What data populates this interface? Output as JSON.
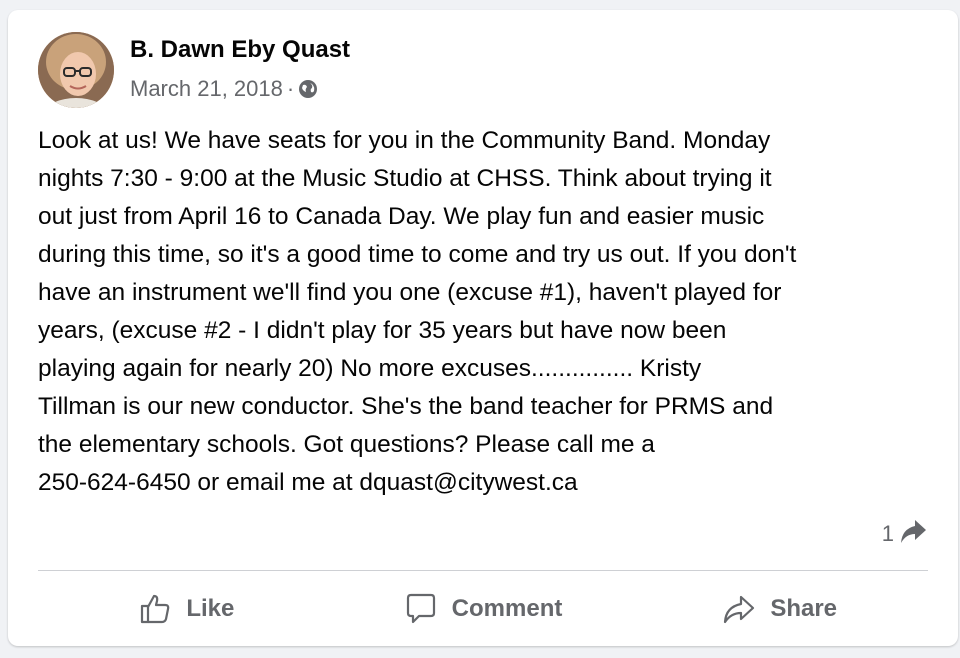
{
  "post": {
    "author_name": "B. Dawn Eby Quast",
    "date": "March 21, 2018",
    "separator": "·",
    "privacy_icon": "globe-icon",
    "body": "Look at us!  We have seats for you in the Community Band.  Monday\nnights 7:30 - 9:00 at the Music Studio at CHSS.   Think about trying it\nout just from April 16 to Canada Day.  We play fun and easier music\nduring this time, so it's a good time to come and try us out.  If you don't\nhave an instrument we'll find you one (excuse #1), haven't played for\nyears, (excuse #2 - I didn't play for 35 years but have now been\nplaying again for nearly 20)   No more excuses...............  Kristy\nTillman is our new conductor.  She's the band teacher for PRMS and\nthe elementary schools.  Got questions?  Please call me a\n250-624-6450 or email me at dquast@citywest.ca",
    "share_count": "1"
  },
  "actions": {
    "like_label": "Like",
    "comment_label": "Comment",
    "share_label": "Share"
  },
  "colors": {
    "background": "#f0f2f5",
    "card": "#ffffff",
    "text": "#050505",
    "secondary_text": "#65676b",
    "divider": "#ced0d4"
  }
}
